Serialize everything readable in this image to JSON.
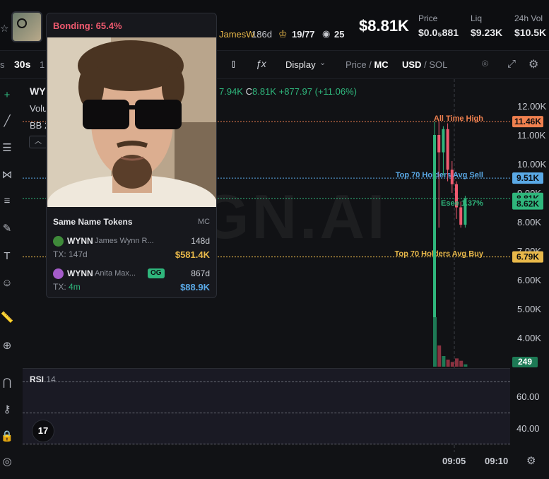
{
  "header": {
    "author_short": "JamesW...",
    "age": "186d",
    "holders": "19/77",
    "watchers": "25",
    "market_cap": "$8.81K",
    "stats": [
      {
        "label": "Price",
        "value": "$0.0₅881"
      },
      {
        "label": "Liq",
        "value": "$9.23K"
      },
      {
        "label": "24h Vol",
        "value": "$10.5K"
      }
    ]
  },
  "toolbar": {
    "interval_partial_left": "s",
    "interval_active": "30s",
    "interval_partial_right": "1",
    "display_label": "Display",
    "price_label": "Price",
    "mc_label": "MC",
    "usd_label": "USD",
    "sol_label": "SOL"
  },
  "legend": {
    "symbol_partial": "WY",
    "ohlc_partial": "7.94K",
    "close_prefix": "C",
    "close_value": "8.81K",
    "change": "+877.97 (+11.06%)",
    "volume_label_partial": "Volu",
    "bb_label_partial": "BB 2"
  },
  "chart_data": {
    "type": "candlestick",
    "y_axis_ticks": [
      "12.00K",
      "11.00K",
      "10.00K",
      "9.00K",
      "8.00K",
      "7.00K",
      "6.00K",
      "5.00K",
      "4.00K"
    ],
    "x_axis_ticks": [
      "09:05",
      "09:10"
    ],
    "ylim": [
      3500,
      12500
    ],
    "reference_lines": [
      {
        "label": "All Time High",
        "value": 11.46,
        "badge": "11.46K",
        "color": "#f0804f"
      },
      {
        "label": "Top 70 Holders Avg Sell",
        "value": 9.51,
        "badge": "9.51K",
        "color": "#5aa9e6"
      },
      {
        "label": "Top 70 Holders Avg Buy",
        "value": 6.79,
        "badge": "6.79K",
        "color": "#e8b84a"
      }
    ],
    "price_badges": [
      {
        "value": "8.81K",
        "color": "#2fb67c"
      },
      {
        "value": "8.62K",
        "color": "#2fb67c"
      }
    ],
    "annotation": "Esee 1.37%",
    "candles": [
      {
        "o": 3700,
        "h": 11460,
        "l": 3600,
        "c": 11000,
        "up": true
      },
      {
        "o": 11000,
        "h": 11460,
        "l": 7800,
        "c": 10400,
        "up": false
      },
      {
        "o": 10400,
        "h": 11300,
        "l": 9600,
        "c": 11200,
        "up": true
      },
      {
        "o": 11200,
        "h": 11400,
        "l": 9400,
        "c": 9800,
        "up": false
      },
      {
        "o": 9800,
        "h": 10100,
        "l": 9000,
        "c": 9300,
        "up": false
      },
      {
        "o": 9300,
        "h": 9400,
        "l": 8100,
        "c": 8500,
        "up": false
      },
      {
        "o": 8500,
        "h": 8700,
        "l": 7800,
        "c": 7900,
        "up": false
      },
      {
        "o": 7900,
        "h": 8900,
        "l": 7800,
        "c": 8810,
        "up": true
      }
    ],
    "volume": [
      420,
      180,
      90,
      60,
      40,
      70,
      50,
      20
    ],
    "volume_badge": "249",
    "rsi": {
      "label": "RSI",
      "period": "14",
      "ticks": [
        "60.00",
        "40.00"
      ]
    }
  },
  "popup": {
    "bonding_label": "Bonding:",
    "bonding_value": "65.4%",
    "same_name_title": "Same Name Tokens",
    "mc_header": "MC",
    "tokens": [
      {
        "symbol": "WYNN",
        "name": "James Wynn R...",
        "age": "148d",
        "tx_label": "TX:",
        "tx": "147d",
        "mc": "$581.4K",
        "mc_color": "#e8b84a",
        "og": ""
      },
      {
        "symbol": "WYNN",
        "name": "Anita Max...",
        "age": "867d",
        "tx_label": "TX:",
        "tx": "4m",
        "mc": "$88.9K",
        "mc_color": "#5aa9e6",
        "og": "OG"
      }
    ]
  },
  "watermark": "GN.AI",
  "tv_logo": "17"
}
